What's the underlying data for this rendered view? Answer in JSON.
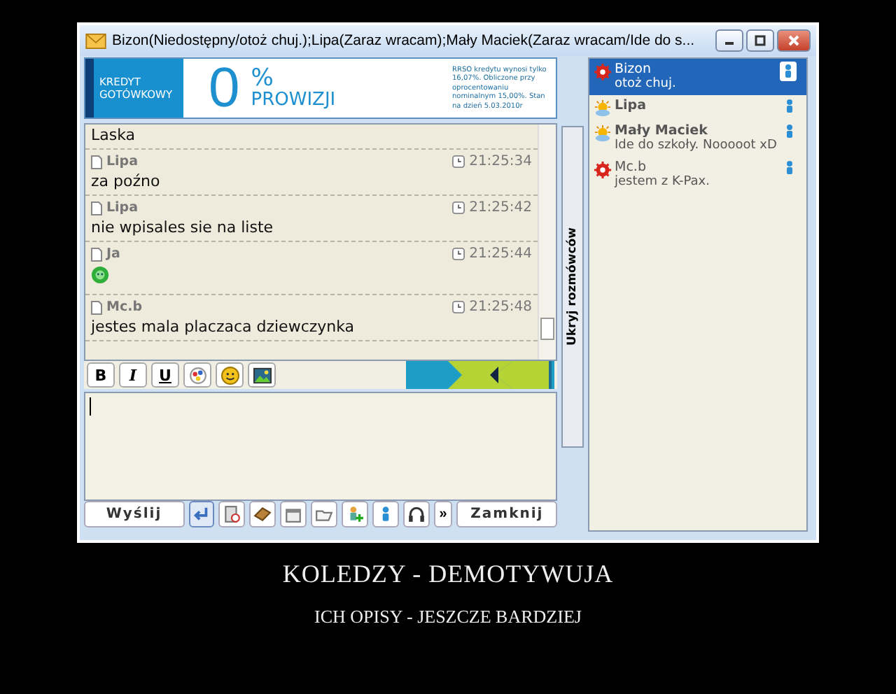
{
  "window": {
    "title": "Bizon(Niedostępny/otoż chuj.);Lipa(Zaraz wracam);Mały Maciek(Zaraz wracam/Ide do s..."
  },
  "ad": {
    "label_line_1": "KREDYT",
    "label_line_2": "GOTÓWKOWY",
    "big": "0",
    "percent": "%",
    "headline": "PROWIZJI",
    "fine_print": "RRSO kredytu wynosi tylko 16,07%. Obliczone przy oprocentowaniu nominalnym 15,00%. Stan na dzień 5.03.2010r"
  },
  "messages": [
    {
      "kind": "text",
      "text": "Laska"
    },
    {
      "kind": "text",
      "author": "Lipa",
      "time": "21:25:34",
      "text": "za poźno"
    },
    {
      "kind": "text",
      "author": "Lipa",
      "time": "21:25:42",
      "text": "nie wpisales sie na liste"
    },
    {
      "kind": "emoticon",
      "author": "Ja",
      "time": "21:25:44"
    },
    {
      "kind": "text",
      "author": "Mc.b",
      "time": "21:25:48",
      "text": "jestes mala placzaca dziewczynka"
    }
  ],
  "format_buttons": [
    {
      "kind": "bold",
      "label": "B"
    },
    {
      "kind": "italic",
      "label": "I"
    },
    {
      "kind": "underline",
      "label": "U"
    },
    {
      "kind": "palette"
    },
    {
      "kind": "smiley"
    },
    {
      "kind": "image"
    }
  ],
  "hide_contacts_tab": "Ukryj rozmówców",
  "contacts": [
    {
      "name": "Bizon",
      "description": "otoż chuj.",
      "kind": "unavailable",
      "selected": true
    },
    {
      "name": "Lipa",
      "kind": "away",
      "selected": false
    },
    {
      "name": "Mały Maciek",
      "description": "Ide do szkoły. Nooooot xD",
      "kind": "away",
      "selected": false
    },
    {
      "name": "Mc.b",
      "description": "jestem z K-Pax.",
      "kind": "unavailable",
      "selected": false
    }
  ],
  "send_button": "Wyślij",
  "more_button": "»",
  "close_button": "Zamknij",
  "caption": {
    "title": "KOLEDZY - DEMOTYWUJA",
    "subtitle": "ICH OPISY - JESZCZE BARDZIEJ"
  }
}
